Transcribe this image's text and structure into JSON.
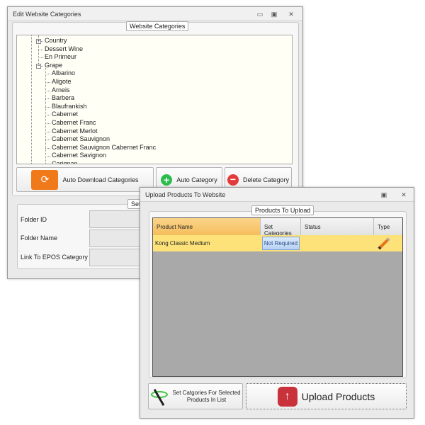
{
  "edit_window": {
    "title": "Edit Website Categories",
    "group_label": "Website Categories",
    "tree": {
      "root_items": [
        {
          "label": "Country",
          "expander": "plus"
        },
        {
          "label": "Dessert Wine"
        },
        {
          "label": "En Primeur"
        },
        {
          "label": "Grape",
          "expander": "minus"
        }
      ],
      "grape_children": [
        "Albarino",
        "Aligote",
        "Arneis",
        "Barbera",
        "Blaufrankish",
        "Cabernet",
        "Cabernet Franc",
        "Cabernet Merlot",
        "Cabernet Sauvignon",
        "Cabernet Sauvignon Cabernet Franc",
        "Cabernet Savignon",
        "Carignan"
      ]
    },
    "buttons": {
      "auto_download": "Auto Download Categories",
      "auto_category": "Auto Category",
      "delete_category": "Delete Category"
    },
    "selected_group_label": "Sele",
    "fields": [
      {
        "label": "Folder ID",
        "value": ""
      },
      {
        "label": "Folder Name",
        "value": ""
      },
      {
        "label": "Link To EPOS Category",
        "value": ""
      }
    ]
  },
  "upload_window": {
    "title": "Upload Products To Website",
    "group_label": "Products To Upload",
    "columns": [
      "Product Name",
      "Set Categories",
      "Status",
      "Type"
    ],
    "rows": [
      {
        "product_name": "Kong Classic Medium",
        "set_categories": "Not Required",
        "status": "",
        "type_icon": "pencil-icon"
      }
    ],
    "buttons": {
      "set_categories": "Set Catgories For Selected Products In List",
      "upload": "Upload Products"
    }
  },
  "colors": {
    "row_highlight": "#fde27a",
    "header_selected": "#f7c56a",
    "folder_orange": "#f07a1a",
    "add_green": "#2dbb4e",
    "delete_red": "#e23b3b",
    "upload_red": "#c9323a"
  }
}
